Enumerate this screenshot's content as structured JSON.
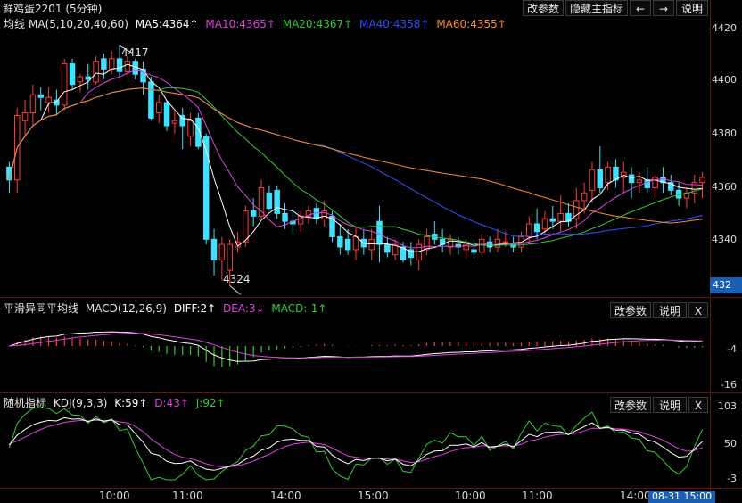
{
  "header": {
    "symbol": "鲜鸡蛋2201 (5分钟)",
    "btn_params": "改参数",
    "btn_hide": "隐藏主指标",
    "btn_left": "←",
    "btn_right": "→",
    "btn_help": "说明"
  },
  "main": {
    "legend_name": "均线",
    "legend_ma": "MA(5,10,20,40,60)",
    "ma5": "MA5:4364↑",
    "ma10": "MA10:4365↑",
    "ma20": "MA20:4367↑",
    "ma40": "MA40:4358↑",
    "ma60": "MA60:4355↑",
    "axis": [
      "4420",
      "4400",
      "4380",
      "4360",
      "4340"
    ],
    "high_label": "4417",
    "low_label": "4324",
    "last_price": "432"
  },
  "macd": {
    "name": "平滑异同平均线",
    "params": "MACD(12,26,9)",
    "diff": "DIFF:2↑",
    "dea": "DEA:3↓",
    "macd": "MACD:-1↑",
    "btn_params": "改参数",
    "btn_help": "说明",
    "btn_close": "X",
    "axis": [
      "-4",
      "-16"
    ]
  },
  "kdj": {
    "name": "随机指标",
    "params": "KDJ(9,3,3)",
    "k": "K:59↑",
    "d": "D:43↑",
    "j": "J:92↑",
    "btn_params": "改参数",
    "btn_help": "说明",
    "btn_close": "X",
    "axis": [
      "103",
      "50",
      "-3"
    ]
  },
  "time_axis": [
    "10:00",
    "11:00",
    "14:00",
    "15:00",
    "10:00",
    "11:00",
    "14:00"
  ],
  "time_tag": "08-31 15:00",
  "colors": {
    "up": "#ff3b3b",
    "down": "#40e0ff",
    "ma5": "#ffffff",
    "ma10": "#e040e0",
    "ma20": "#33cc33",
    "ma40": "#3050ff",
    "ma60": "#ff8a2a",
    "divider": "#6b0f0f"
  },
  "chart_data": [
    {
      "type": "candlestick",
      "title": "鲜鸡蛋2201 (5分钟)",
      "ylim": [
        4320,
        4425
      ],
      "candles": [
        [
          4370,
          4372,
          4360,
          4365
        ],
        [
          4365,
          4393,
          4360,
          4390
        ],
        [
          4388,
          4396,
          4382,
          4391
        ],
        [
          4391,
          4402,
          4386,
          4398
        ],
        [
          4398,
          4401,
          4392,
          4397
        ],
        [
          4395,
          4401,
          4391,
          4397
        ],
        [
          4396,
          4400,
          4390,
          4394
        ],
        [
          4394,
          4412,
          4392,
          4410
        ],
        [
          4410,
          4412,
          4400,
          4402
        ],
        [
          4403,
          4406,
          4399,
          4405
        ],
        [
          4405,
          4410,
          4400,
          4404
        ],
        [
          4403,
          4413,
          4402,
          4411
        ],
        [
          4412,
          4414,
          4404,
          4408
        ],
        [
          4408,
          4415,
          4406,
          4412
        ],
        [
          4412,
          4417,
          4405,
          4407
        ],
        [
          4407,
          4413,
          4406,
          4411
        ],
        [
          4411,
          4412,
          4404,
          4406
        ],
        [
          4408,
          4411,
          4398,
          4403
        ],
        [
          4403,
          4405,
          4388,
          4389
        ],
        [
          4391,
          4398,
          4387,
          4395
        ],
        [
          4395,
          4396,
          4384,
          4386
        ],
        [
          4387,
          4392,
          4383,
          4388
        ],
        [
          4390,
          4393,
          4377,
          4386
        ],
        [
          4382,
          4391,
          4378,
          4388
        ],
        [
          4389,
          4391,
          4377,
          4378
        ],
        [
          4382,
          4383,
          4340,
          4342
        ],
        [
          4342,
          4346,
          4328,
          4334
        ],
        [
          4334,
          4343,
          4326,
          4340
        ],
        [
          4330,
          4342,
          4324,
          4340
        ],
        [
          4339,
          4345,
          4337,
          4341
        ],
        [
          4341,
          4355,
          4339,
          4353
        ],
        [
          4353,
          4358,
          4347,
          4351
        ],
        [
          4351,
          4365,
          4350,
          4362
        ],
        [
          4360,
          4363,
          4353,
          4354
        ],
        [
          4361,
          4363,
          4350,
          4352
        ],
        [
          4352,
          4356,
          4346,
          4349
        ],
        [
          4349,
          4354,
          4344,
          4348
        ],
        [
          4348,
          4353,
          4345,
          4351
        ],
        [
          4351,
          4355,
          4348,
          4353
        ],
        [
          4354,
          4356,
          4348,
          4350
        ],
        [
          4350,
          4357,
          4347,
          4353
        ],
        [
          4351,
          4353,
          4341,
          4343
        ],
        [
          4343,
          4348,
          4336,
          4339
        ],
        [
          4342,
          4346,
          4336,
          4338
        ],
        [
          4338,
          4347,
          4334,
          4343
        ],
        [
          4342,
          4346,
          4336,
          4339
        ],
        [
          4338,
          4346,
          4334,
          4342
        ],
        [
          4349,
          4355,
          4333,
          4340
        ],
        [
          4340,
          4343,
          4335,
          4337
        ],
        [
          4336,
          4342,
          4334,
          4340
        ],
        [
          4339,
          4341,
          4333,
          4334
        ],
        [
          4338,
          4341,
          4332,
          4335
        ],
        [
          4334,
          4342,
          4330,
          4340
        ],
        [
          4338,
          4346,
          4336,
          4343
        ],
        [
          4344,
          4349,
          4340,
          4342
        ],
        [
          4342,
          4346,
          4337,
          4340
        ],
        [
          4339,
          4344,
          4336,
          4342
        ],
        [
          4340,
          4343,
          4336,
          4339
        ],
        [
          4338,
          4342,
          4335,
          4340
        ],
        [
          4338,
          4342,
          4335,
          4337
        ],
        [
          4337,
          4344,
          4336,
          4342
        ],
        [
          4341,
          4343,
          4337,
          4339
        ],
        [
          4339,
          4346,
          4337,
          4342
        ],
        [
          4341,
          4345,
          4339,
          4341
        ],
        [
          4340,
          4343,
          4337,
          4339
        ],
        [
          4339,
          4345,
          4337,
          4343
        ],
        [
          4343,
          4351,
          4340,
          4348
        ],
        [
          4348,
          4354,
          4342,
          4345
        ],
        [
          4346,
          4353,
          4344,
          4350
        ],
        [
          4350,
          4355,
          4346,
          4349
        ],
        [
          4349,
          4359,
          4345,
          4352
        ],
        [
          4352,
          4356,
          4347,
          4349
        ],
        [
          4350,
          4362,
          4346,
          4357
        ],
        [
          4357,
          4364,
          4352,
          4360
        ],
        [
          4361,
          4372,
          4356,
          4369
        ],
        [
          4369,
          4378,
          4360,
          4362
        ],
        [
          4364,
          4372,
          4361,
          4370
        ],
        [
          4370,
          4373,
          4362,
          4365
        ],
        [
          4366,
          4372,
          4360,
          4368
        ],
        [
          4367,
          4370,
          4358,
          4364
        ],
        [
          4364,
          4368,
          4360,
          4365
        ],
        [
          4365,
          4370,
          4360,
          4362
        ],
        [
          4362,
          4367,
          4358,
          4366
        ],
        [
          4366,
          4370,
          4360,
          4364
        ],
        [
          4364,
          4367,
          4359,
          4361
        ],
        [
          4361,
          4364,
          4355,
          4358
        ],
        [
          4358,
          4362,
          4354,
          4360
        ],
        [
          4360,
          4367,
          4356,
          4364
        ],
        [
          4364,
          4368,
          4358,
          4366
        ]
      ]
    },
    {
      "type": "bar",
      "title": "MACD(12,26,9)",
      "series": [
        {
          "name": "DIFF",
          "value": 2
        },
        {
          "name": "DEA",
          "value": 3
        },
        {
          "name": "MACD",
          "value": -1
        }
      ]
    },
    {
      "type": "line",
      "title": "KDJ(9,3,3)",
      "ylim": [
        -3,
        103
      ],
      "series": [
        {
          "name": "K",
          "value": 59
        },
        {
          "name": "D",
          "value": 43
        },
        {
          "name": "J",
          "value": 92
        }
      ]
    }
  ]
}
